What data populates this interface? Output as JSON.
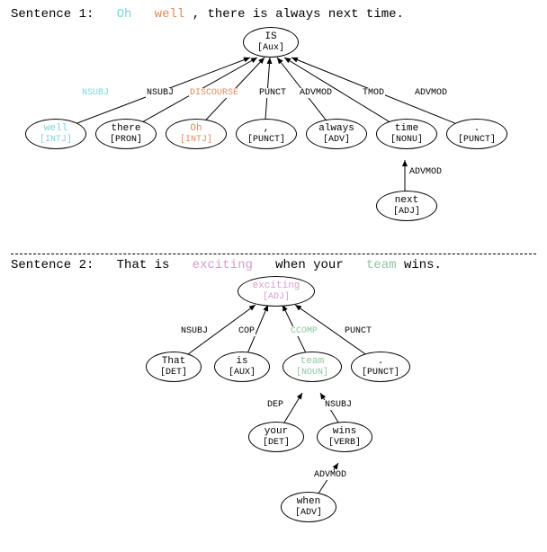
{
  "sentence1": {
    "label": "Sentence 1:",
    "tokens": {
      "oh": "Oh",
      "well": "well",
      "comma": ",",
      "rest": " there is always next time."
    },
    "root": {
      "word": "IS",
      "pos": "[Aux]"
    },
    "children": [
      {
        "word": "well",
        "pos": "[INTJ]",
        "rel": "NSUBJ",
        "color": "t-cyan"
      },
      {
        "word": "there",
        "pos": "[PRON]",
        "rel": "NSUBJ",
        "color": ""
      },
      {
        "word": "Oh",
        "pos": "[INTJ]",
        "rel": "DISCOURSE",
        "color": "t-orange"
      },
      {
        "word": ",",
        "pos": "[PUNCT]",
        "rel": "PUNCT",
        "color": ""
      },
      {
        "word": "always",
        "pos": "[ADV]",
        "rel": "ADVMOD",
        "color": ""
      },
      {
        "word": "time",
        "pos": "[NONU]",
        "rel": "TMOD",
        "color": ""
      },
      {
        "word": ".",
        "pos": "[PUNCT]",
        "rel": "ADVMOD",
        "color": ""
      }
    ],
    "grandchild": {
      "word": "next",
      "pos": "[ADJ]",
      "rel": "ADVMOD"
    }
  },
  "sentence2": {
    "label": "Sentence 2:",
    "tokens": {
      "that_is": "That is ",
      "exciting": "exciting",
      "when_your": " when your ",
      "team": "team",
      "wins": " wins."
    },
    "root": {
      "word": "exciting",
      "pos": "[ADJ]"
    },
    "children": [
      {
        "word": "That",
        "pos": "[DET]",
        "rel": "NSUBJ"
      },
      {
        "word": "is",
        "pos": "[AUX]",
        "rel": "COP"
      },
      {
        "word": "team",
        "pos": "[NOUN]",
        "rel": "CCOMP",
        "color": "t-green"
      },
      {
        "word": ".",
        "pos": "[PUNCT]",
        "rel": "PUNCT"
      }
    ],
    "team_children": [
      {
        "word": "your",
        "pos": "[DET]",
        "rel": "DEP"
      },
      {
        "word": "wins",
        "pos": "[VERB]",
        "rel": "NSUBJ"
      }
    ],
    "wins_child": {
      "word": "when",
      "pos": "[ADV]",
      "rel": "ADVMOD"
    }
  }
}
